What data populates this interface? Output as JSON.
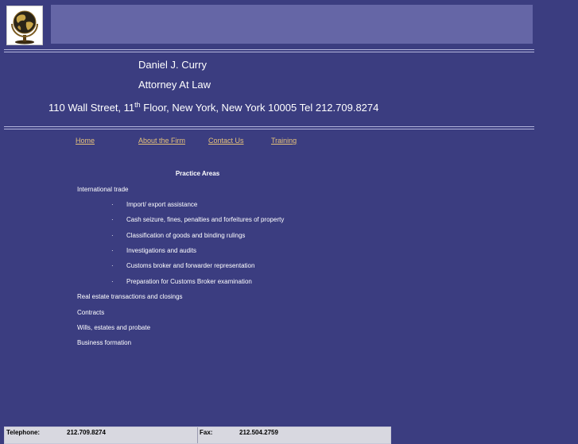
{
  "header": {
    "name": "Daniel J. Curry",
    "title": "Attorney At Law",
    "address_a": "110 Wall Street, 11",
    "address_sup": "th",
    "address_b": " Floor,  New York, New York 10005   Tel 212.709.8274"
  },
  "nav": {
    "home": "Home",
    "about": "About the Firm",
    "contact": "Contact Us",
    "training": "Training"
  },
  "practice": {
    "heading": "Practice Areas",
    "international_trade": "International trade",
    "bullet": "·",
    "sub_items": [
      "Import/ export assistance",
      "Cash seizure, fines, penalties and forfeitures of property",
      "Classification of goods and binding rulings",
      "Investigations and audits",
      "Customs broker and forwarder representation",
      "Preparation for Customs Broker examination"
    ],
    "other_areas": [
      "Real estate transactions and closings",
      "Contracts",
      "Wills, estates and probate",
      "Business formation"
    ]
  },
  "footer": {
    "telephone_label": "Telephone:",
    "telephone_value": "212.709.8274",
    "fax_label": "Fax:",
    "fax_value": "212.504.2759"
  },
  "colors": {
    "background": "#3b3d80",
    "banner": "#6566a6",
    "link": "#e6c27a"
  },
  "icons": {
    "logo": "globe-icon"
  }
}
